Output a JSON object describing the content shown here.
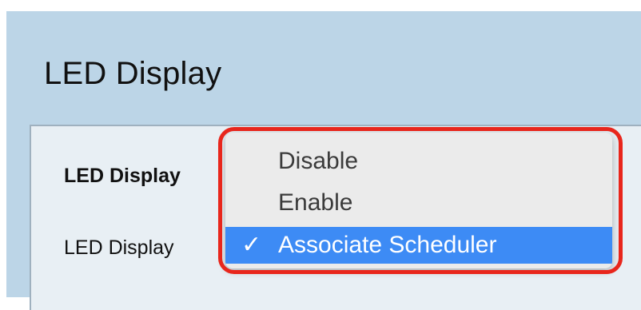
{
  "page": {
    "title": "LED Display"
  },
  "panel": {
    "section_label": "LED Display",
    "field_label": "LED Display"
  },
  "dropdown": {
    "options": [
      {
        "label": "Disable"
      },
      {
        "label": "Enable"
      },
      {
        "label": "Associate Scheduler"
      }
    ],
    "selected_index": 2,
    "check_icon": "checkmark-icon",
    "highlight_color": "#e8261c",
    "selected_color": "#3d8bf5"
  }
}
